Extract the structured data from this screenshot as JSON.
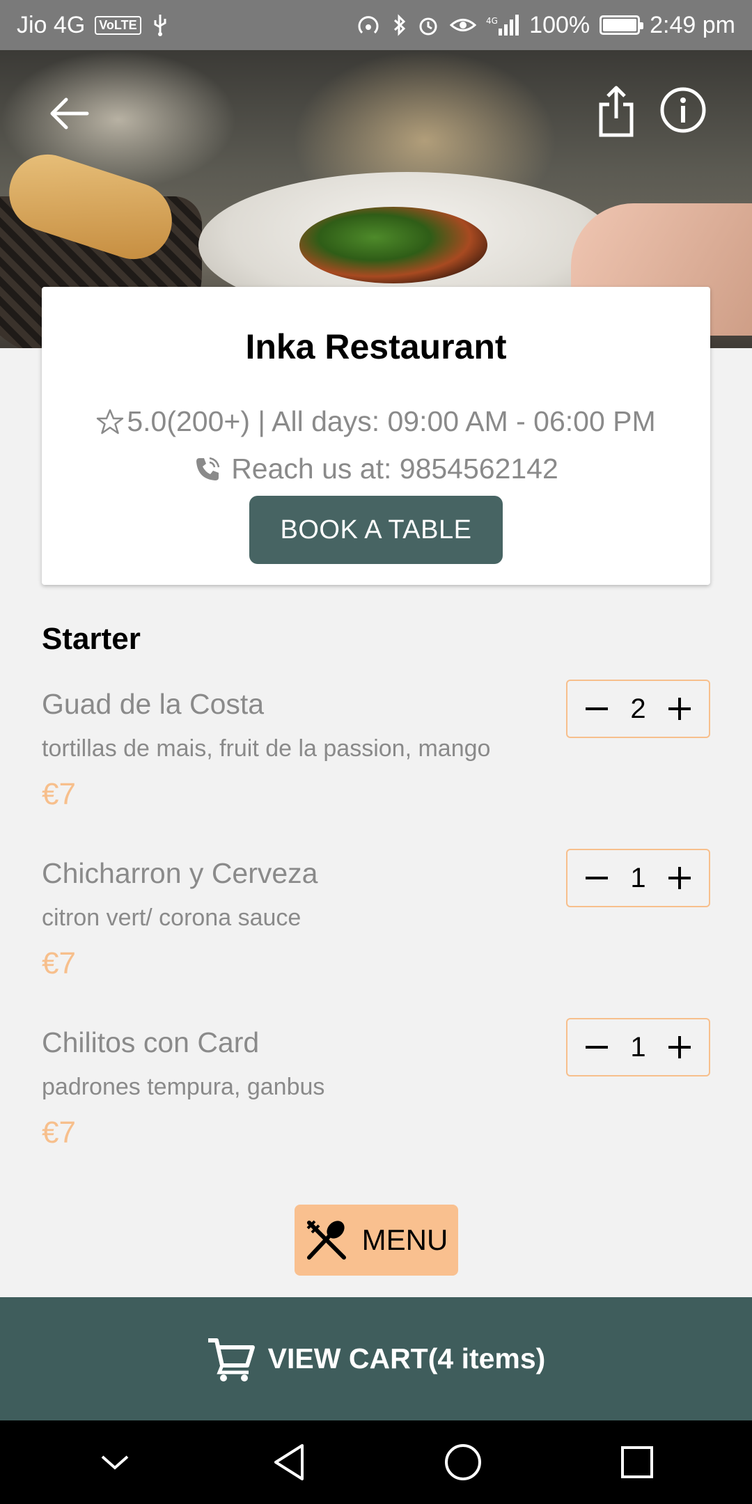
{
  "status_bar": {
    "carrier": "Jio 4G",
    "volte": "VoLTE",
    "network": "4G",
    "battery": "100%",
    "battery_level": 1.0,
    "time": "2:49 pm"
  },
  "header": {
    "back_icon": "arrow-left-icon",
    "share_icon": "share-icon",
    "info_icon": "info-icon"
  },
  "restaurant": {
    "name": "Inka Restaurant",
    "rating_text": "5.0(200+) | All days: 09:00 AM - 06:00 PM",
    "phone_text": "Reach us at: 9854562142",
    "book_label": "BOOK A TABLE"
  },
  "section": {
    "title": "Starter",
    "items": [
      {
        "name": "Guad de la Costa",
        "desc": "tortillas de mais, fruit de la passion, mango",
        "price": "€7",
        "qty": "2"
      },
      {
        "name": "Chicharron y Cerveza",
        "desc": "citron vert/ corona sauce",
        "price": "€7",
        "qty": "1"
      },
      {
        "name": "Chilitos con Card",
        "desc": "padrones tempura, ganbus",
        "price": "€7",
        "qty": "1"
      }
    ]
  },
  "menu_button": {
    "label": "MENU",
    "icon": "utensils-icon"
  },
  "cart": {
    "label": "VIEW CART(4 items)",
    "icon": "cart-icon"
  },
  "colors": {
    "primary": "#476463",
    "accent": "#f9c08f",
    "price": "#f7bf8c",
    "cart_bar": "#3f5d5c"
  }
}
